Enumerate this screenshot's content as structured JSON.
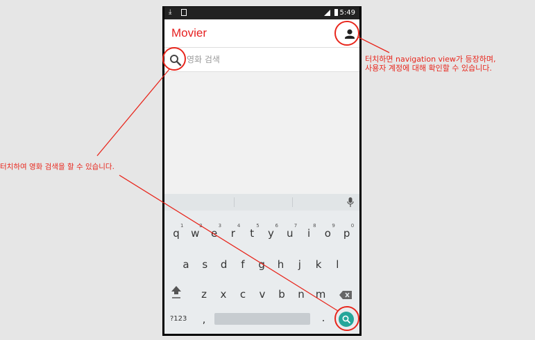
{
  "status_bar": {
    "time": "5:49",
    "left_icons": [
      "download-icon",
      "image-icon"
    ],
    "right_icons": [
      "signal-icon",
      "battery-icon"
    ]
  },
  "app_bar": {
    "title": "Movier",
    "account_icon": "account-icon"
  },
  "search": {
    "placeholder": "영화 검색",
    "icon": "search-icon"
  },
  "keyboard": {
    "row1": [
      "q",
      "w",
      "e",
      "r",
      "t",
      "y",
      "u",
      "i",
      "o",
      "p"
    ],
    "row1_numbers": [
      "1",
      "2",
      "3",
      "4",
      "5",
      "6",
      "7",
      "8",
      "9",
      "0"
    ],
    "row2": [
      "a",
      "s",
      "d",
      "f",
      "g",
      "h",
      "j",
      "k",
      "l"
    ],
    "row3": [
      "z",
      "x",
      "c",
      "v",
      "b",
      "n",
      "m"
    ],
    "bottom": {
      "symbols_label": "?123",
      "comma": ",",
      "period": "."
    },
    "icons": [
      "mic-icon",
      "shift-icon",
      "backspace-icon",
      "search-go-icon"
    ]
  },
  "annotations": {
    "account": [
      "터치하면 navigation view가 등장하며,",
      "사용자 계정에 대해 확인할 수 있습니다."
    ],
    "search": "터치하여 영화 검색을 할 수 있습니다."
  },
  "colors": {
    "accent": "#e52020",
    "annotation": "#e8261c",
    "go_button": "#26a69a"
  }
}
